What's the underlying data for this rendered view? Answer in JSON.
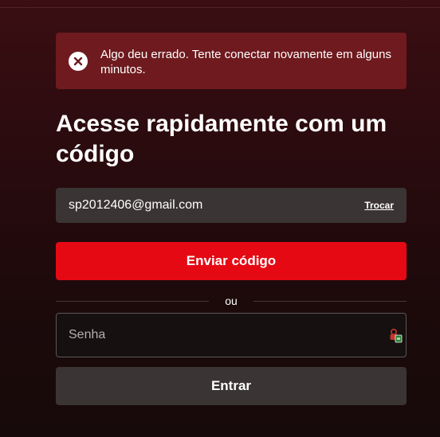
{
  "alert": {
    "message": "Algo deu errado. Tente conectar novamente em alguns minutos.",
    "icon": "close-circle-icon"
  },
  "title": "Acesse rapidamente com um código",
  "email": {
    "value": "sp2012406@gmail.com",
    "change_label": "Trocar"
  },
  "send_code_label": "Enviar código",
  "divider_label": "ou",
  "password": {
    "placeholder": "Senha",
    "manager_icon": "password-manager-icon"
  },
  "enter_label": "Entrar",
  "colors": {
    "accent": "#e50914",
    "alert_bg": "#6e1a1e",
    "field_bg": "#3b3434"
  }
}
